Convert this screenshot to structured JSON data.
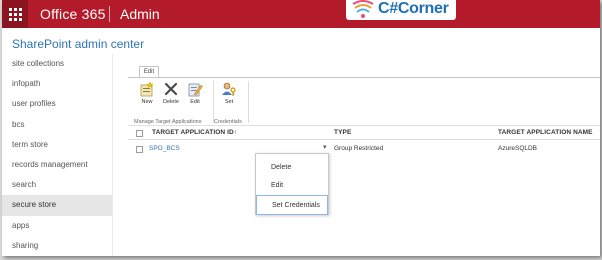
{
  "suite": {
    "title": "Office 365",
    "section": "Admin",
    "logo_text": "C#Corner"
  },
  "header": {
    "title": "SharePoint admin center"
  },
  "sidebar": {
    "items": [
      {
        "label": "site collections"
      },
      {
        "label": "infopath"
      },
      {
        "label": "user profiles"
      },
      {
        "label": "bcs"
      },
      {
        "label": "term store"
      },
      {
        "label": "records management"
      },
      {
        "label": "search"
      },
      {
        "label": "secure store",
        "active": true
      },
      {
        "label": "apps"
      },
      {
        "label": "sharing"
      }
    ]
  },
  "ribbon": {
    "tab": "Edit",
    "groups": [
      {
        "label": "Manage Target Applications",
        "buttons": [
          "New",
          "Delete",
          "Edit"
        ]
      },
      {
        "label": "Credentials",
        "buttons": [
          "Set"
        ]
      }
    ]
  },
  "table": {
    "columns": [
      "TARGET APPLICATION ID↑",
      "TYPE",
      "TARGET APPLICATION NAME"
    ],
    "rows": [
      {
        "id": "SPO_BCS",
        "type": "Group Restricted",
        "name": "AzureSQLDB"
      }
    ]
  },
  "context_menu": {
    "items": [
      "Delete",
      "Edit",
      "Set Credentials"
    ],
    "highlighted": "Set Credentials"
  },
  "colors": {
    "suite_bar": "#b31b2b",
    "accent_link": "#2e75b6",
    "active_nav": "#e6e6e6"
  }
}
